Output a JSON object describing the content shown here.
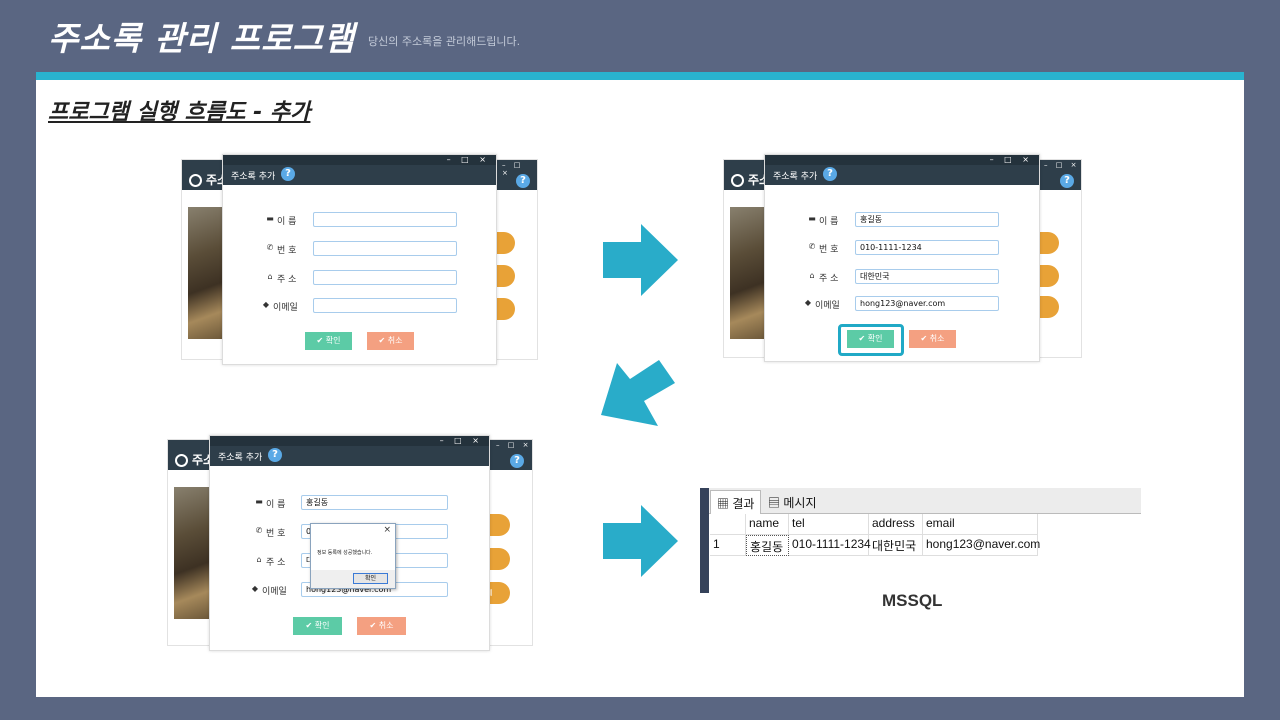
{
  "header": {
    "title": "주소록 관리 프로그램",
    "subtitle": "당신의 주소록을 관리해드립니다."
  },
  "section_title": "프로그램 실행 흐름도 - 추가",
  "back_window": {
    "title": "주소",
    "pill_label": "제"
  },
  "dialog": {
    "title": "주소록 추가",
    "help": "?",
    "window_controls": "– □ ×",
    "labels": {
      "name": "이 름",
      "phone": "번 호",
      "address": "주 소",
      "email": "이메일"
    },
    "ok_label": "확인",
    "cancel_label": "취소"
  },
  "step_filled": {
    "name": "홍길동",
    "phone": "010-1111-1234",
    "address": "대한민국",
    "email": "hong123@naver.com"
  },
  "step_result": {
    "name": "홍길동",
    "phone": "01",
    "address": "대",
    "email": "hong123@naver.com",
    "message": "정보 등록에 성공했습니다.",
    "message_ok": "확인",
    "message_close": "×"
  },
  "sql": {
    "tabs": [
      "결과",
      "메시지"
    ],
    "columns": [
      "name",
      "tel",
      "address",
      "email"
    ],
    "rows": [
      {
        "num": "1",
        "name": "홍길동",
        "tel": "010-1111-1234",
        "address": "대한민국",
        "email": "hong123@naver.com"
      }
    ],
    "caption": "MSSQL"
  }
}
